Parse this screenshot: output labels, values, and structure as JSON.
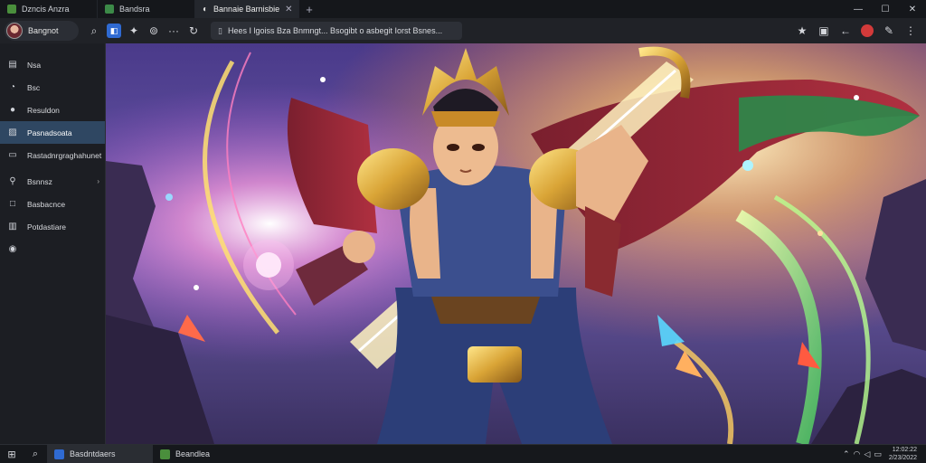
{
  "tabs": [
    {
      "label": "Dzncis Anzra",
      "favicon_color": "#4a8f3c"
    },
    {
      "label": "Bandsra",
      "favicon_color": "#3c8a48"
    },
    {
      "label": "Bannaie Barnisbie",
      "favicon_color": "#d8d8d8",
      "active": true
    }
  ],
  "window_controls": {
    "minimize": "—",
    "maximize": "☐",
    "close": "✕"
  },
  "toolbar": {
    "profile_name": "Bangnot",
    "address": "Hees I lgoiss Bza Bnmngt... Bsogibt o asbegit Iorst Bsnes..."
  },
  "sidebar": {
    "items": [
      {
        "label": "Nsa",
        "icon": "id-card-icon"
      },
      {
        "label": "Bsc",
        "icon": "headphones-icon"
      },
      {
        "label": "Resuldon",
        "icon": "chat-bubble-icon"
      },
      {
        "label": "Pasnadsoata",
        "icon": "gallery-icon",
        "active": true
      },
      {
        "label": "Rastadnrgraghahunet",
        "icon": "folder-icon"
      },
      {
        "label": "Bsnnsz",
        "icon": "wrench-icon",
        "has_caret": true
      },
      {
        "label": "Basbacnce",
        "icon": "window-icon"
      },
      {
        "label": "Potdastiare",
        "icon": "database-icon"
      },
      {
        "label": "",
        "icon": "circle-icon"
      }
    ]
  },
  "taskbar": {
    "apps": [
      {
        "label": "Basdntdaers",
        "color": "#2f6ad2",
        "active": true
      },
      {
        "label": "Beandlea",
        "color": "#4a8f3c"
      }
    ],
    "clock_time": "12:02:22",
    "clock_date": "2/23/2022"
  },
  "colors": {
    "sidebar_active": "#2f4762",
    "accent_blue": "#2f6ad2",
    "chrome_dark": "#15171b"
  }
}
